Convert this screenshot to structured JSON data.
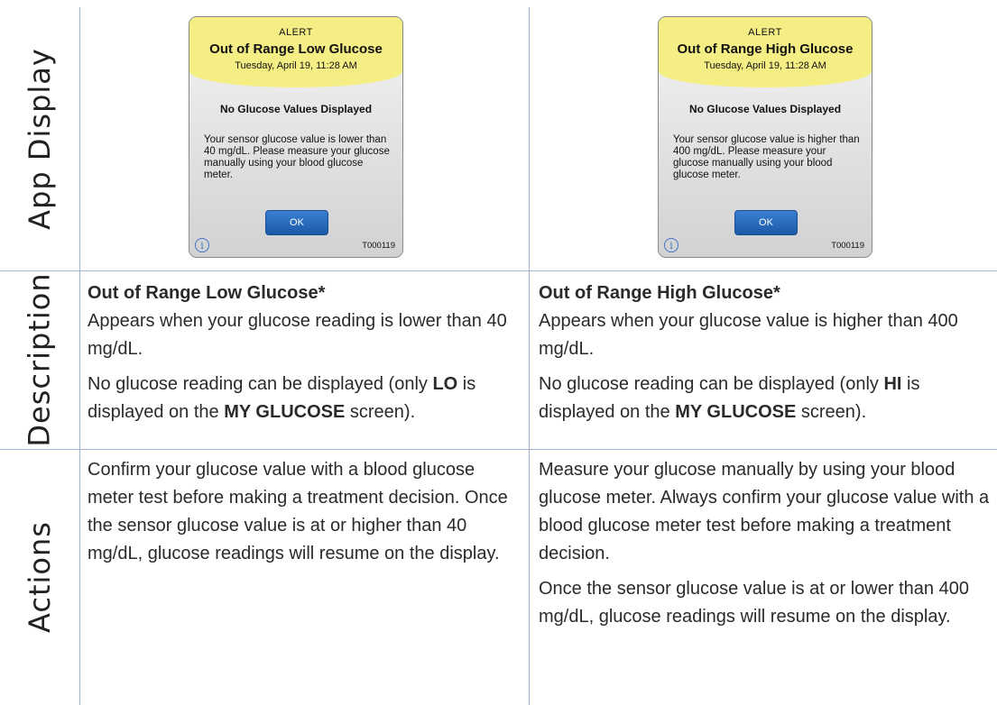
{
  "rows": {
    "app_display": "App Display",
    "description": "Description",
    "actions": "Actions"
  },
  "left": {
    "alert": {
      "kicker": "ALERT",
      "title": "Out of Range Low Glucose",
      "date": "Tuesday, April 19, 11:28 AM",
      "subtitle": "No Glucose Values Displayed",
      "body": "Your sensor glucose value is lower than 40 mg/dL. Please measure your glucose manually using your blood glucose meter.",
      "ok": "OK",
      "info": "i",
      "code": "T000119"
    },
    "description": {
      "heading": "Out of Range Low Glucose*",
      "line1": "Appears when your glucose reading is lower than 40 mg/dL.",
      "line2_pre": "No glucose reading can be displayed (only ",
      "line2_bold1": "LO",
      "line2_mid": " is displayed on the ",
      "line2_bold2": "MY GLUCOSE",
      "line2_post": " screen)."
    },
    "actions": {
      "p1": "Confirm your glucose value with a blood glucose meter test before making a treatment decision. Once the sensor glucose value is at or higher than 40 mg/dL, glucose readings will resume on the display."
    }
  },
  "right": {
    "alert": {
      "kicker": "ALERT",
      "title": "Out of Range High Glucose",
      "date": "Tuesday, April 19, 11:28 AM",
      "subtitle": "No Glucose Values Displayed",
      "body": "Your sensor glucose value is higher than 400 mg/dL. Please measure your glucose manually using your blood glucose meter.",
      "ok": "OK",
      "info": "i",
      "code": "T000119"
    },
    "description": {
      "heading": "Out of Range High Glucose*",
      "line1": "Appears when your glucose value is higher than 400 mg/dL.",
      "line2_pre": "No glucose reading can be displayed (only ",
      "line2_bold1": "HI",
      "line2_mid": " is displayed on the ",
      "line2_bold2": "MY GLUCOSE",
      "line2_post": " screen)."
    },
    "actions": {
      "p1": "Measure your glucose manually by using your blood glucose meter. Always confirm your glucose value with a blood glucose meter test before making a treatment decision.",
      "p2": "Once the sensor glucose value is at or lower than 400 mg/dL, glucose readings will resume on the display."
    }
  }
}
